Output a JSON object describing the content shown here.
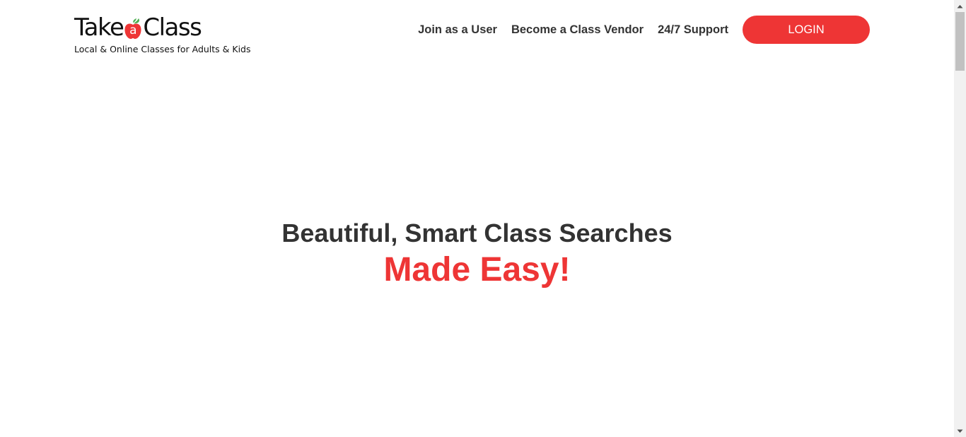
{
  "header": {
    "logo": {
      "text_before": "Take",
      "apple_letter": "a",
      "text_after": "Class",
      "tagline": "Local & Online Classes for Adults & Kids"
    },
    "nav": {
      "join_user": "Join as a User",
      "become_vendor": "Become a Class Vendor",
      "support": "24/7 Support",
      "login": "LOGIN"
    }
  },
  "hero": {
    "title": "Beautiful, Smart Class Searches",
    "accent": "Made Easy!"
  },
  "colors": {
    "brand_red": "#ee3535",
    "leaf_green": "#4caf50",
    "text_dark": "#333333"
  },
  "icons": {
    "logo_apple": "apple-icon",
    "scroll_up": "chevron-up-icon",
    "scroll_down": "chevron-down-icon"
  }
}
